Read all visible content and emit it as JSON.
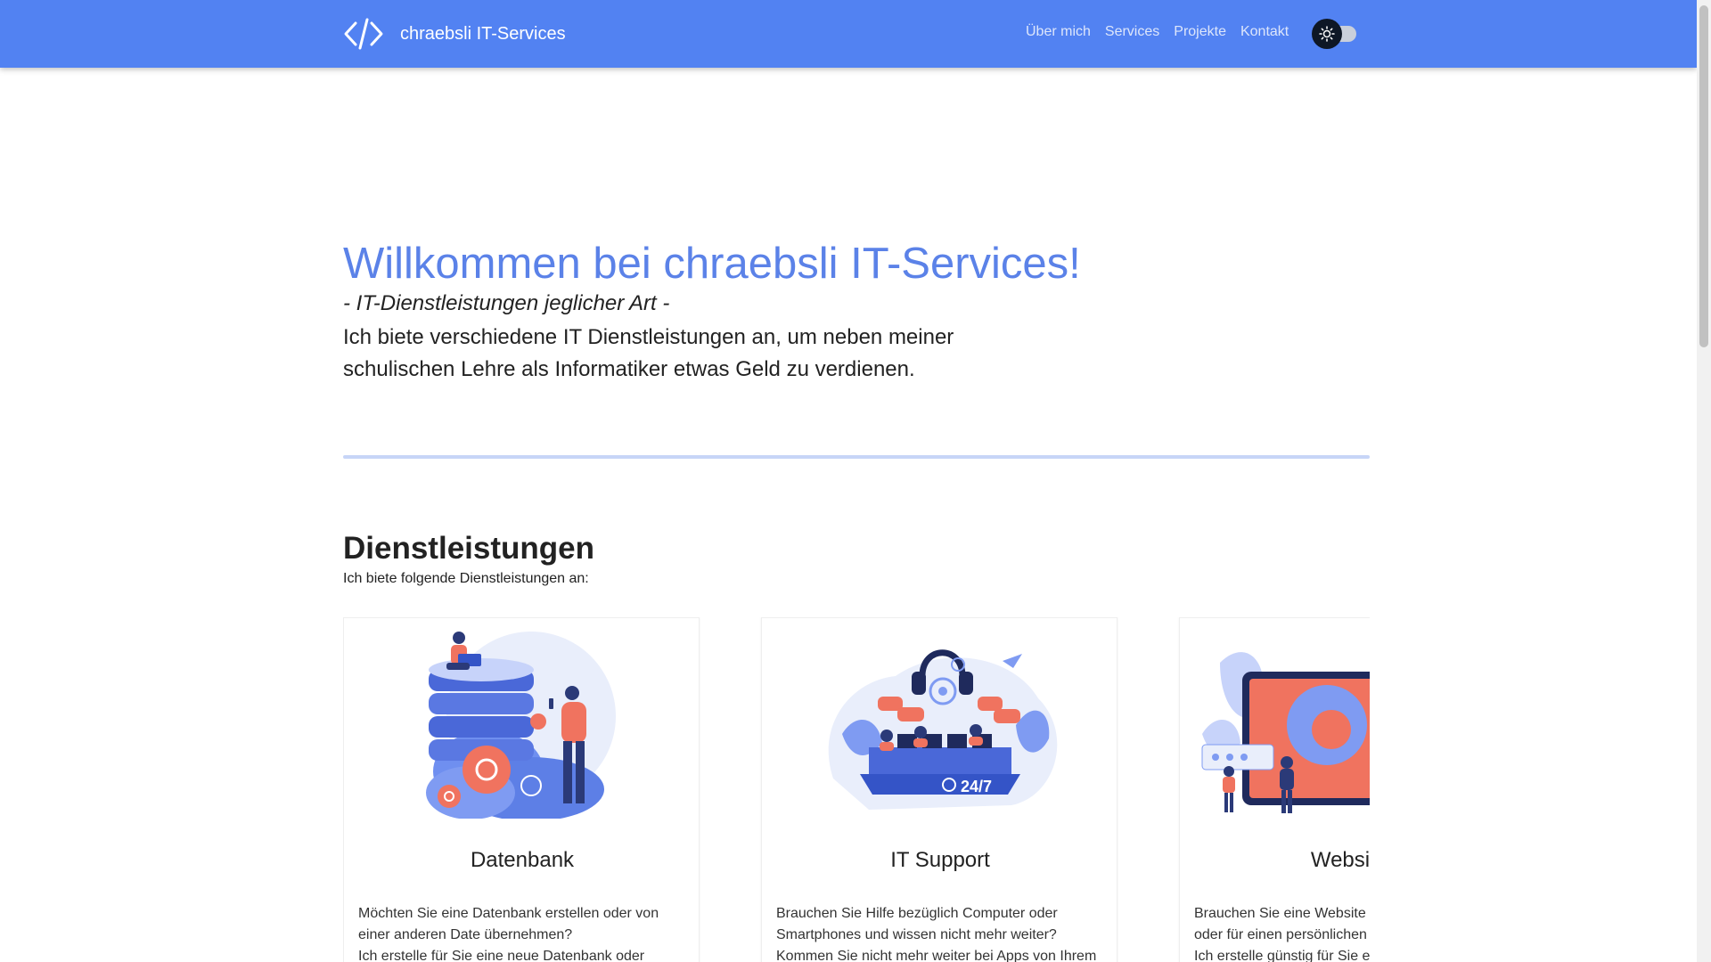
{
  "navbar": {
    "brand": "chraebsli IT-Services",
    "links": [
      "Über mich",
      "Services",
      "Projekte",
      "Kontakt"
    ],
    "colors": {
      "background": "#5282f2"
    },
    "theme_toggle_icon": "sun-icon"
  },
  "hero": {
    "title": "Willkommen bei chraebsli IT-Services!",
    "subtitle": "- IT-Dienstleistungen jeglicher Art -",
    "line1": "Ich biete verschiedene IT Dienstleistungen an, um neben meiner",
    "line2": "schulischen Lehre als Informatiker etwas Geld zu verdienen.",
    "title_color": "#5b82e8"
  },
  "services": {
    "title": "Dienstleistungen",
    "subtitle": "Ich biete folgende Dienstleistungen an:",
    "cards": [
      {
        "title": "Datenbank",
        "image": "database-illustration",
        "lines": [
          "Möchten Sie eine Datenbank erstellen oder von",
          "einer anderen Date übernehmen?",
          "Ich erstelle für Sie eine neue Datenbank oder"
        ]
      },
      {
        "title": "IT Support",
        "image": "it-support-24-7-illustration",
        "badge": "24/7",
        "lines": [
          "Brauchen Sie Hilfe bezüglich Computer oder",
          "Smartphones und wissen nicht mehr weiter?",
          "Kommen Sie nicht mehr weiter bei Apps von Ihrem"
        ]
      },
      {
        "title": "Website e",
        "image": "website-illustration",
        "lines": [
          "Brauchen Sie eine Website",
          "oder für einen persönlichen",
          "Ich erstelle günstig für Sie e"
        ]
      }
    ]
  }
}
